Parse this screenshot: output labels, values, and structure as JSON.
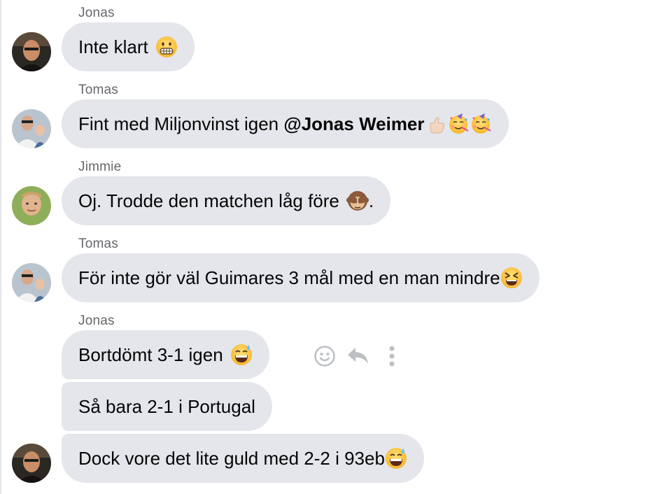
{
  "messages": [
    {
      "sender": "Jonas",
      "text": "Inte klart",
      "emoji": [
        "grimacing-face"
      ]
    },
    {
      "sender": "Tomas",
      "text_before": "Fint med Miljonvinst igen ",
      "mention": "@Jonas Weimer",
      "emoji": [
        "thumbs-up-light",
        "partying-face",
        "partying-face"
      ]
    },
    {
      "sender": "Jimmie",
      "text": "Oj. Trodde den matchen låg före",
      "emoji": [
        "see-no-evil-monkey"
      ],
      "text_after": "."
    },
    {
      "sender": "Tomas",
      "text": "För inte gör väl Guimares 3 mål med en man mindre",
      "emoji": [
        "laughing-squinting-face"
      ]
    },
    {
      "sender": "Jonas",
      "group": [
        {
          "text": "Bortdömt 3-1 igen",
          "emoji": [
            "grinning-sweat-face"
          ]
        },
        {
          "text": "Så bara 2-1 i Portugal"
        },
        {
          "text": "Dock vore det lite guld med 2-2 i 93eb",
          "emoji": [
            "grinning-sweat-face"
          ]
        }
      ]
    }
  ],
  "actions": {
    "react_icon": "smiley-icon",
    "reply_icon": "reply-icon",
    "more_icon": "more-vertical-icon"
  },
  "colors": {
    "bubble": "#e4e6eb",
    "sender": "#65676b",
    "text": "#050505",
    "icon": "#bcc0c4"
  }
}
